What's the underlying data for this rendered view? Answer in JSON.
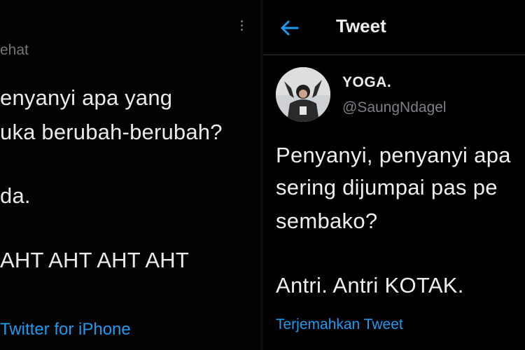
{
  "left_tweet": {
    "handle_fragment": "ehat",
    "lines": [
      "enyanyi apa yang",
      "uka berubah-berubah?",
      "da.",
      "AHT AHT AHT AHT"
    ],
    "source": "Twitter for iPhone",
    "menu_icon": "more-vertical-icon"
  },
  "right_tweet": {
    "header_title": "Tweet",
    "back_icon": "arrow-left-icon",
    "display_name": "YOGA.",
    "username": "@SaungNdagel",
    "lines": [
      "Penyanyi, penyanyi apa",
      "sering dijumpai pas pe",
      "sembako?",
      "Antri. Antri KOTAK."
    ],
    "translate_link": "Terjemahkan Tweet"
  },
  "colors": {
    "background": "#000000",
    "text": "#e7e9ea",
    "muted": "#71767b",
    "accent": "#1d9bf0"
  }
}
